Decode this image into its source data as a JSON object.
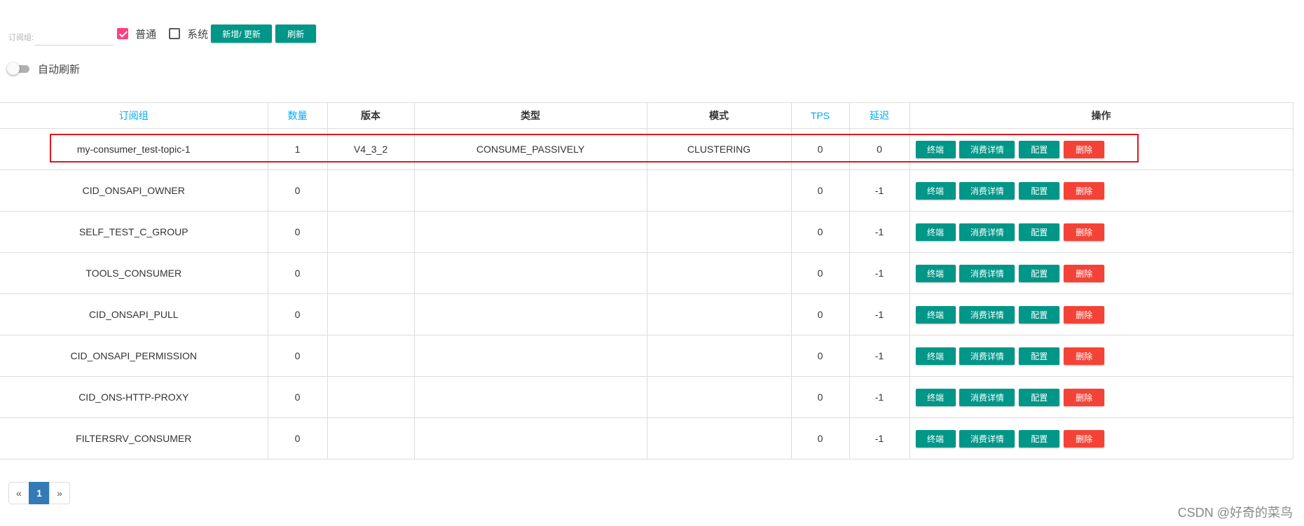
{
  "filter": {
    "label": "订阅组:",
    "value": "",
    "normal_label": "普通",
    "normal_checked": true,
    "system_label": "系统",
    "system_checked": false,
    "add_update_label": "新增/ 更新",
    "refresh_label": "刷新"
  },
  "auto_refresh": {
    "label": "自动刷新",
    "enabled": false
  },
  "table": {
    "headers": {
      "group": "订阅组",
      "count": "数量",
      "version": "版本",
      "type": "类型",
      "mode": "模式",
      "tps": "TPS",
      "delay": "延迟",
      "ops": "操作"
    },
    "row_actions": {
      "stop": "终端",
      "detail": "消费详情",
      "config": "配置",
      "delete": "删除"
    },
    "rows": [
      {
        "group": "my-consumer_test-topic-1",
        "count": "1",
        "version": "V4_3_2",
        "type": "CONSUME_PASSIVELY",
        "mode": "CLUSTERING",
        "tps": "0",
        "delay": "0"
      },
      {
        "group": "CID_ONSAPI_OWNER",
        "count": "0",
        "version": "",
        "type": "",
        "mode": "",
        "tps": "0",
        "delay": "-1"
      },
      {
        "group": "SELF_TEST_C_GROUP",
        "count": "0",
        "version": "",
        "type": "",
        "mode": "",
        "tps": "0",
        "delay": "-1"
      },
      {
        "group": "TOOLS_CONSUMER",
        "count": "0",
        "version": "",
        "type": "",
        "mode": "",
        "tps": "0",
        "delay": "-1"
      },
      {
        "group": "CID_ONSAPI_PULL",
        "count": "0",
        "version": "",
        "type": "",
        "mode": "",
        "tps": "0",
        "delay": "-1"
      },
      {
        "group": "CID_ONSAPI_PERMISSION",
        "count": "0",
        "version": "",
        "type": "",
        "mode": "",
        "tps": "0",
        "delay": "-1"
      },
      {
        "group": "CID_ONS-HTTP-PROXY",
        "count": "0",
        "version": "",
        "type": "",
        "mode": "",
        "tps": "0",
        "delay": "-1"
      },
      {
        "group": "FILTERSRV_CONSUMER",
        "count": "0",
        "version": "",
        "type": "",
        "mode": "",
        "tps": "0",
        "delay": "-1"
      }
    ]
  },
  "pagination": {
    "prev": "«",
    "current": "1",
    "next": "»"
  },
  "watermark": "CSDN @好奇的菜鸟",
  "colors": {
    "primary_green": "#009688",
    "danger_red": "#f44336",
    "sort_blue": "#03a9f4",
    "checkbox_pink": "#ff4081",
    "page_active_blue": "#337ab7",
    "highlight_red": "#e0161c"
  }
}
